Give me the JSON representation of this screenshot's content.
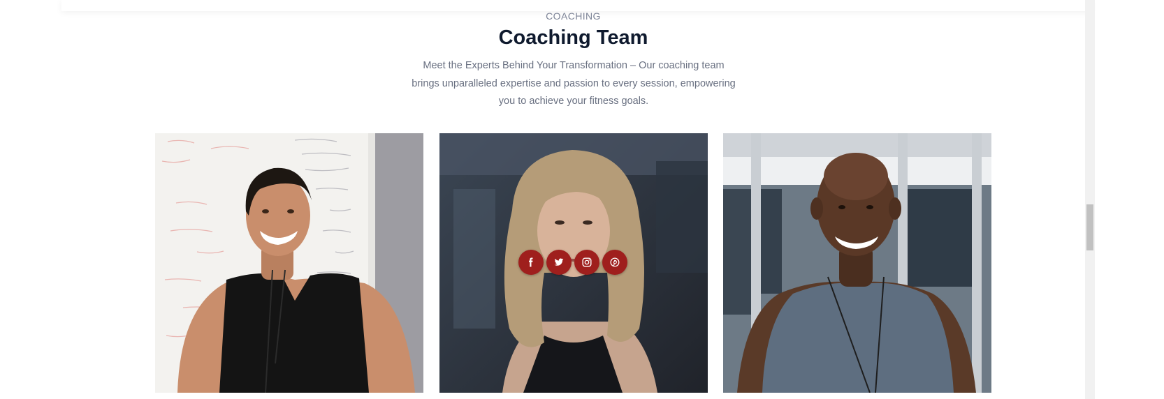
{
  "section": {
    "eyebrow": "COACHING",
    "title": "Coaching Team",
    "description_lines": [
      "Meet the Experts Behind Your Transformation – Our coaching team",
      "brings unparalleled expertise and passion to every session, empowering",
      "you to achieve your fitness goals."
    ]
  },
  "team": [
    {
      "photo": "coach-photo-man-black-tank",
      "accent": "#1a1a1a"
    },
    {
      "photo": "coach-photo-woman-curly-hair",
      "accent": "#15161a"
    },
    {
      "photo": "coach-photo-man-grey-tank",
      "accent": "#5e6e80"
    }
  ],
  "socials": [
    {
      "icon": "facebook-icon"
    },
    {
      "icon": "twitter-icon"
    },
    {
      "icon": "instagram-icon"
    },
    {
      "icon": "pinterest-icon"
    }
  ],
  "colors": {
    "accent": "#9f1f1d",
    "heading": "#0f1a2e",
    "text": "#686f80"
  }
}
